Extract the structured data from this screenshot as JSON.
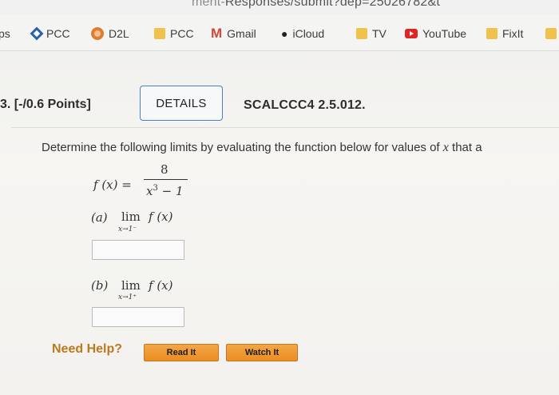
{
  "browser": {
    "url_visible": "ment-Responses/submit?dep=25026782&t",
    "url_faded": "ment-",
    "url_main": "Responses/submit?dep=25026782&t"
  },
  "bookmarks": [
    {
      "label": "ps",
      "icon": "apps-icon"
    },
    {
      "label": "PCC",
      "icon": "diamond-icon"
    },
    {
      "label": "D2L",
      "icon": "d2l-icon"
    },
    {
      "label": "PCC",
      "icon": "folder-icon"
    },
    {
      "label": "Gmail",
      "icon": "gmail-icon"
    },
    {
      "label": "iCloud",
      "icon": "apple-icon"
    },
    {
      "label": "TV",
      "icon": "folder-icon"
    },
    {
      "label": "YouTube",
      "icon": "youtube-icon"
    },
    {
      "label": "FixIt",
      "icon": "folder-icon"
    }
  ],
  "question": {
    "number": "3.",
    "points": "[-/0.6 Points]",
    "details_label": "DETAILS",
    "code": "SCALCCC4 2.5.012.",
    "prompt_start": "Determine the following limits by evaluating the function below for values of ",
    "prompt_var": "x",
    "prompt_end": " that a",
    "function": {
      "lhs": "f (x) =",
      "numerator": "8",
      "denominator_base": "x",
      "denominator_exp": "3",
      "denominator_rest": " − 1"
    },
    "parts": [
      {
        "label": "(a)",
        "lim": "lim",
        "func": "f (x)",
        "subscript": "x→1⁻",
        "answer": ""
      },
      {
        "label": "(b)",
        "lim": "lim",
        "func": "f (x)",
        "subscript": "x→1⁺",
        "answer": ""
      }
    ]
  },
  "help": {
    "label": "Need Help?",
    "read_it": "Read It",
    "watch_it": "Watch It"
  },
  "colors": {
    "accent_blue": "#4a7fc0",
    "help_orange": "#bb7a1c",
    "button_orange": "#ea8e21"
  }
}
